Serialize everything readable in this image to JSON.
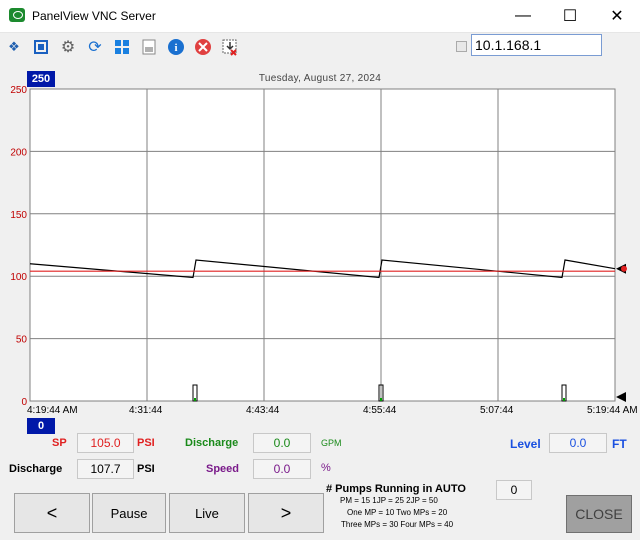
{
  "window": {
    "title": "PanelView VNC Server",
    "min_icon": "minimize-icon",
    "max_icon": "maximize-icon",
    "close_icon": "close-icon"
  },
  "toolbar": {
    "icons": [
      "connection-icon",
      "fullscreen-icon",
      "settings-icon",
      "refresh-icon",
      "windows-icon",
      "file-transfer-icon",
      "info-icon",
      "disconnect-icon",
      "exit-icon"
    ],
    "address": "10.1.168.1"
  },
  "trend": {
    "date": "Tuesday, August 27, 2024",
    "y_max_box": "250",
    "y_min_box": "0",
    "y_ticks": [
      "250",
      "200",
      "150",
      "100",
      "50",
      "0"
    ],
    "x_ticks": [
      "4:19:44 AM",
      "4:31:44",
      "4:43:44",
      "4:55:44",
      "5:07:44",
      "5:19:44 AM"
    ],
    "colors": {
      "pressure": "#000000",
      "setpoint": "#e02020",
      "pumps": "#00a000",
      "grid": "#808080"
    }
  },
  "chart_data": {
    "type": "line",
    "x": [
      "4:19:44 AM",
      "4:31:44",
      "4:43:44",
      "4:55:44",
      "5:07:44",
      "5:19:44 AM"
    ],
    "ylim": [
      0,
      250
    ],
    "series": [
      {
        "values": [
          110,
          99,
          113,
          99,
          113,
          99,
          113,
          106
        ]
      },
      {
        "values": [
          104,
          104
        ]
      }
    ]
  },
  "readouts": {
    "sp_label": "SP",
    "sp_value": "105.0",
    "sp_unit": "PSI",
    "discharge_flow_label": "Discharge",
    "discharge_flow_value": "0.0",
    "discharge_flow_unit": "GPM",
    "level_label": "Level",
    "level_value": "0.0",
    "level_unit": "FT",
    "discharge_label": "Discharge",
    "discharge_value": "107.7",
    "discharge_unit": "PSI",
    "speed_label": "Speed",
    "speed_value": "0.0",
    "speed_unit": "%",
    "pumps_title": "# Pumps Running in AUTO",
    "pumps_value": "0",
    "pumps_line1": "PM =  15   1JP =  25  2JP = 50",
    "pumps_line2": "One MP = 10 Two MPs = 20",
    "pumps_line3": "Three MPs = 30 Four MPs = 40"
  },
  "buttons": {
    "prev": "<",
    "pause": "Pause",
    "live": "Live",
    "next": ">",
    "close": "CLOSE"
  }
}
